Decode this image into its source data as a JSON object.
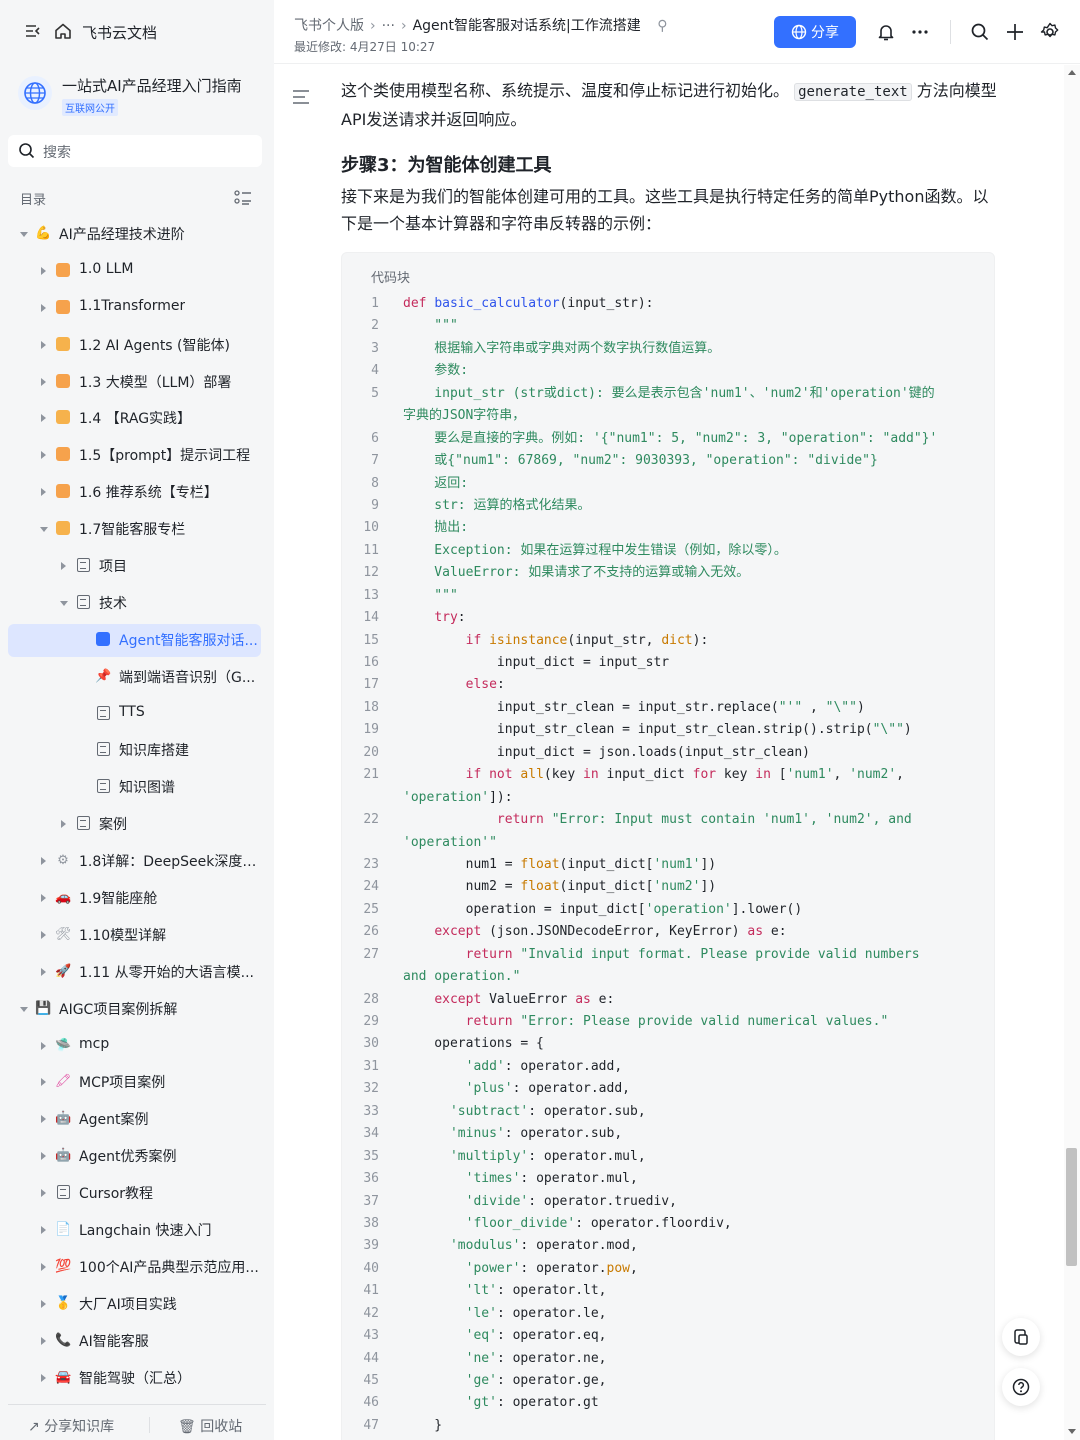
{
  "app": {
    "title": "飞书云文档"
  },
  "knowledge_base": {
    "name": "一站式AI产品经理入门指南",
    "tag": "互联网公开"
  },
  "search": {
    "placeholder": "搜索"
  },
  "toc": {
    "label": "目录"
  },
  "tree": [
    {
      "label": "AI产品经理技术进阶",
      "level": 0,
      "arrow": "down",
      "icon": "emoji",
      "glyph": "💪",
      "color": "#f5a623"
    },
    {
      "label": "1.0 LLM",
      "level": 1,
      "arrow": "right",
      "icon": "square",
      "color": "#f6a24c"
    },
    {
      "label": "1.1Transformer",
      "level": 1,
      "arrow": "right",
      "icon": "square",
      "color": "#f6a24c"
    },
    {
      "label": "1.2 AI Agents (智能体)",
      "level": 1,
      "arrow": "right",
      "icon": "square",
      "color": "#f6b24c"
    },
    {
      "label": "1.3 大模型（LLM）部署",
      "level": 1,
      "arrow": "right",
      "icon": "square",
      "color": "#f6a24c"
    },
    {
      "label": "1.4 【RAG实践】",
      "level": 1,
      "arrow": "right",
      "icon": "square",
      "color": "#f6b24c"
    },
    {
      "label": "1.5【prompt】提示词工程",
      "level": 1,
      "arrow": "right",
      "icon": "square",
      "color": "#f6a24c"
    },
    {
      "label": "1.6 推荐系统【专栏】",
      "level": 1,
      "arrow": "right",
      "icon": "square",
      "color": "#f6a24c"
    },
    {
      "label": "1.7智能客服专栏",
      "level": 1,
      "arrow": "down",
      "icon": "square",
      "color": "#f6b24c"
    },
    {
      "label": "项目",
      "level": 2,
      "arrow": "right",
      "icon": "doc"
    },
    {
      "label": "技术",
      "level": 2,
      "arrow": "down",
      "icon": "doc"
    },
    {
      "label": "Agent智能客服对话...",
      "level": 3,
      "arrow": "",
      "icon": "doc-blue",
      "active": true
    },
    {
      "label": "端到端语音识别（G...",
      "level": 3,
      "arrow": "",
      "icon": "emoji",
      "glyph": "📌",
      "color": "#e03e3e"
    },
    {
      "label": "TTS",
      "level": 3,
      "arrow": "",
      "icon": "doc"
    },
    {
      "label": "知识库搭建",
      "level": 3,
      "arrow": "",
      "icon": "doc"
    },
    {
      "label": "知识图谱",
      "level": 3,
      "arrow": "",
      "icon": "doc"
    },
    {
      "label": "案例",
      "level": 2,
      "arrow": "right",
      "icon": "doc"
    },
    {
      "label": "1.8详解：DeepSeek深度推...",
      "level": 1,
      "arrow": "right",
      "icon": "emoji",
      "glyph": "⚙",
      "color": "#8f959e"
    },
    {
      "label": "1.9智能座舱",
      "level": 1,
      "arrow": "right",
      "icon": "emoji",
      "glyph": "🚗",
      "color": "#e03e3e"
    },
    {
      "label": "1.10模型详解",
      "level": 1,
      "arrow": "right",
      "icon": "emoji",
      "glyph": "🛠",
      "color": "#8f959e"
    },
    {
      "label": "1.11 从零开始的大语言模...",
      "level": 1,
      "arrow": "right",
      "icon": "emoji",
      "glyph": "🚀",
      "color": "#3370ff"
    },
    {
      "label": "AIGC项目案例拆解",
      "level": 0,
      "arrow": "down",
      "icon": "emoji",
      "glyph": "💾",
      "color": "#7a3bc4"
    },
    {
      "label": "mcp",
      "level": 1,
      "arrow": "right",
      "icon": "emoji",
      "glyph": "🛸",
      "color": "#3370ff"
    },
    {
      "label": "MCP项目案例",
      "level": 1,
      "arrow": "right",
      "icon": "emoji",
      "glyph": "🖍",
      "color": "#e0479e"
    },
    {
      "label": "Agent案例",
      "level": 1,
      "arrow": "right",
      "icon": "emoji",
      "glyph": "🤖",
      "color": "#646a73"
    },
    {
      "label": "Agent优秀案例",
      "level": 1,
      "arrow": "right",
      "icon": "emoji",
      "glyph": "🤖",
      "color": "#646a73"
    },
    {
      "label": "Cursor教程",
      "level": 1,
      "arrow": "right",
      "icon": "doc"
    },
    {
      "label": "Langchain 快速入门",
      "level": 1,
      "arrow": "right",
      "icon": "emoji",
      "glyph": "📄",
      "color": "#e03e3e"
    },
    {
      "label": "100个AI产品典型示范应用...",
      "level": 1,
      "arrow": "right",
      "icon": "emoji",
      "glyph": "💯",
      "color": "#e03e3e"
    },
    {
      "label": "大厂AI项目实践",
      "level": 1,
      "arrow": "right",
      "icon": "emoji",
      "glyph": "🥇",
      "color": "#f5a623"
    },
    {
      "label": "AI智能客服",
      "level": 1,
      "arrow": "right",
      "icon": "emoji",
      "glyph": "📞",
      "color": "#e03e3e"
    },
    {
      "label": "智能驾驶（汇总）",
      "level": 1,
      "arrow": "right",
      "icon": "emoji",
      "glyph": "🚘",
      "color": "#e03e3e"
    }
  ],
  "sidebar_bottom": {
    "share_kb": "分享知识库",
    "recycle": "回收站"
  },
  "header": {
    "crumb_root": "飞书个人版",
    "crumb_more": "···",
    "crumb_title": "Agent智能客服对话系统|工作流搭建",
    "modified": "最近修改: 4月27日 10:27",
    "share_label": "分享"
  },
  "content": {
    "para1_a": "这个类使用模型名称、系统提示、温度和停止标记进行初始化。",
    "para1_code": "generate_text",
    "para1_b": "方法向模型API发送请求并返回响应。",
    "step3": "步骤3：为智能体创建工具",
    "para2": "接下来是为我们的智能体创建可用的工具。这些工具是执行特定任务的简单Python函数。以下是一个基本计算器和字符串反转器的示例：",
    "codeblock_title": "代码块"
  },
  "code_lines": [
    {
      "n": "1",
      "segs": [
        [
          "k",
          "def "
        ],
        [
          "f",
          "basic_calculator"
        ],
        [
          "",
          "(input_str):"
        ]
      ]
    },
    {
      "n": "2",
      "segs": [
        [
          "d",
          "    \"\"\""
        ]
      ]
    },
    {
      "n": "3",
      "segs": [
        [
          "d",
          "    根据输入字符串或字典对两个数字执行数值运算。"
        ]
      ]
    },
    {
      "n": "4",
      "segs": [
        [
          "d",
          "    参数:"
        ]
      ]
    },
    {
      "n": "5",
      "segs": [
        [
          "d",
          "    input_str (str或dict): 要么是表示包含'num1'、'num2'和'operation'键的"
        ]
      ]
    },
    {
      "n": "",
      "segs": [
        [
          "d",
          "字典的JSON字符串，"
        ]
      ]
    },
    {
      "n": "6",
      "segs": [
        [
          "d",
          "    要么是直接的字典。例如: '{\"num1\": 5, \"num2\": 3, \"operation\": \"add\"}'"
        ]
      ]
    },
    {
      "n": "7",
      "segs": [
        [
          "d",
          "    或{\"num1\": 67869, \"num2\": 9030393, \"operation\": \"divide\"}"
        ]
      ]
    },
    {
      "n": "8",
      "segs": [
        [
          "d",
          "    返回:"
        ]
      ]
    },
    {
      "n": "9",
      "segs": [
        [
          "d",
          "    str: 运算的格式化结果。"
        ]
      ]
    },
    {
      "n": "10",
      "segs": [
        [
          "d",
          "    抛出:"
        ]
      ]
    },
    {
      "n": "11",
      "segs": [
        [
          "d",
          "    Exception: 如果在运算过程中发生错误（例如，除以零）。"
        ]
      ]
    },
    {
      "n": "12",
      "segs": [
        [
          "d",
          "    ValueError: 如果请求了不支持的运算或输入无效。"
        ]
      ]
    },
    {
      "n": "13",
      "segs": [
        [
          "d",
          "    \"\"\""
        ]
      ]
    },
    {
      "n": "14",
      "segs": [
        [
          "",
          "    "
        ],
        [
          "k",
          "try"
        ],
        [
          "",
          ":"
        ]
      ]
    },
    {
      "n": "15",
      "segs": [
        [
          "",
          "        "
        ],
        [
          "k",
          "if "
        ],
        [
          "b",
          "isinstance"
        ],
        [
          "",
          "(input_str, "
        ],
        [
          "b",
          "dict"
        ],
        [
          "",
          "):"
        ]
      ]
    },
    {
      "n": "16",
      "segs": [
        [
          "",
          "            input_dict = input_str"
        ]
      ]
    },
    {
      "n": "17",
      "segs": [
        [
          "",
          "        "
        ],
        [
          "k",
          "else"
        ],
        [
          "",
          ":"
        ]
      ]
    },
    {
      "n": "18",
      "segs": [
        [
          "",
          "            input_str_clean = input_str.replace("
        ],
        [
          "s",
          "\"'\""
        ],
        [
          "",
          " , "
        ],
        [
          "s",
          "\"\\\"\""
        ],
        [
          "",
          ")"
        ]
      ]
    },
    {
      "n": "19",
      "segs": [
        [
          "",
          "            input_str_clean = input_str_clean.strip().strip("
        ],
        [
          "s",
          "\"\\\"\""
        ],
        [
          "",
          ")"
        ]
      ]
    },
    {
      "n": "20",
      "segs": [
        [
          "",
          "            input_dict = json.loads(input_str_clean)"
        ]
      ]
    },
    {
      "n": "21",
      "segs": [
        [
          "",
          "        "
        ],
        [
          "k",
          "if not "
        ],
        [
          "b",
          "all"
        ],
        [
          "",
          "(key "
        ],
        [
          "k",
          "in"
        ],
        [
          "",
          " input_dict "
        ],
        [
          "k",
          "for"
        ],
        [
          "",
          " key "
        ],
        [
          "k",
          "in"
        ],
        [
          "",
          " ["
        ],
        [
          "s",
          "'num1'"
        ],
        [
          "",
          ", "
        ],
        [
          "s",
          "'num2'"
        ],
        [
          "",
          ","
        ]
      ]
    },
    {
      "n": "",
      "segs": [
        [
          "s",
          "'operation'"
        ],
        [
          "",
          "]):"
        ]
      ]
    },
    {
      "n": "22",
      "segs": [
        [
          "",
          "            "
        ],
        [
          "k",
          "return "
        ],
        [
          "s",
          "\"Error: Input must contain 'num1', 'num2', and"
        ]
      ]
    },
    {
      "n": "",
      "segs": [
        [
          "s",
          "'operation'\""
        ]
      ]
    },
    {
      "n": "23",
      "segs": [
        [
          "",
          "        num1 = "
        ],
        [
          "b",
          "float"
        ],
        [
          "",
          "(input_dict["
        ],
        [
          "s",
          "'num1'"
        ],
        [
          "",
          "])"
        ]
      ]
    },
    {
      "n": "24",
      "segs": [
        [
          "",
          "        num2 = "
        ],
        [
          "b",
          "float"
        ],
        [
          "",
          "(input_dict["
        ],
        [
          "s",
          "'num2'"
        ],
        [
          "",
          "])"
        ]
      ]
    },
    {
      "n": "25",
      "segs": [
        [
          "",
          "        operation = input_dict["
        ],
        [
          "s",
          "'operation'"
        ],
        [
          "",
          "].lower()"
        ]
      ]
    },
    {
      "n": "26",
      "segs": [
        [
          "",
          "    "
        ],
        [
          "k",
          "except"
        ],
        [
          "",
          " (json.JSONDecodeError, KeyError) "
        ],
        [
          "k",
          "as"
        ],
        [
          "",
          " e:"
        ]
      ]
    },
    {
      "n": "27",
      "segs": [
        [
          "",
          "        "
        ],
        [
          "k",
          "return "
        ],
        [
          "s",
          "\"Invalid input format. Please provide valid numbers"
        ]
      ]
    },
    {
      "n": "",
      "segs": [
        [
          "s",
          "and operation.\""
        ]
      ]
    },
    {
      "n": "28",
      "segs": [
        [
          "",
          "    "
        ],
        [
          "k",
          "except"
        ],
        [
          "",
          " ValueError "
        ],
        [
          "k",
          "as"
        ],
        [
          "",
          " e:"
        ]
      ]
    },
    {
      "n": "29",
      "segs": [
        [
          "",
          "        "
        ],
        [
          "k",
          "return "
        ],
        [
          "s",
          "\"Error: Please provide valid numerical values.\""
        ]
      ]
    },
    {
      "n": "30",
      "segs": [
        [
          "",
          "    operations = {"
        ]
      ]
    },
    {
      "n": "31",
      "segs": [
        [
          "",
          "        "
        ],
        [
          "s",
          "'add'"
        ],
        [
          "",
          ": operator.add,"
        ]
      ]
    },
    {
      "n": "32",
      "segs": [
        [
          "",
          "        "
        ],
        [
          "s",
          "'plus'"
        ],
        [
          "",
          ": operator.add,"
        ]
      ]
    },
    {
      "n": "33",
      "segs": [
        [
          "",
          "      "
        ],
        [
          "s",
          "'subtract'"
        ],
        [
          "",
          ": operator.sub,"
        ]
      ]
    },
    {
      "n": "34",
      "segs": [
        [
          "",
          "      "
        ],
        [
          "s",
          "'minus'"
        ],
        [
          "",
          ": operator.sub,"
        ]
      ]
    },
    {
      "n": "35",
      "segs": [
        [
          "",
          "      "
        ],
        [
          "s",
          "'multiply'"
        ],
        [
          "",
          ": operator.mul,"
        ]
      ]
    },
    {
      "n": "36",
      "segs": [
        [
          "",
          "        "
        ],
        [
          "s",
          "'times'"
        ],
        [
          "",
          ": operator.mul,"
        ]
      ]
    },
    {
      "n": "37",
      "segs": [
        [
          "",
          "        "
        ],
        [
          "s",
          "'divide'"
        ],
        [
          "",
          ": operator.truediv,"
        ]
      ]
    },
    {
      "n": "38",
      "segs": [
        [
          "",
          "        "
        ],
        [
          "s",
          "'floor_divide'"
        ],
        [
          "",
          ": operator.floordiv,"
        ]
      ]
    },
    {
      "n": "39",
      "segs": [
        [
          "",
          "      "
        ],
        [
          "s",
          "'modulus'"
        ],
        [
          "",
          ": operator.mod,"
        ]
      ]
    },
    {
      "n": "40",
      "segs": [
        [
          "",
          "        "
        ],
        [
          "s",
          "'power'"
        ],
        [
          "",
          ": operator."
        ],
        [
          "b",
          "pow"
        ],
        [
          "",
          ","
        ]
      ]
    },
    {
      "n": "41",
      "segs": [
        [
          "",
          "        "
        ],
        [
          "s",
          "'lt'"
        ],
        [
          "",
          ": operator.lt,"
        ]
      ]
    },
    {
      "n": "42",
      "segs": [
        [
          "",
          "        "
        ],
        [
          "s",
          "'le'"
        ],
        [
          "",
          ": operator.le,"
        ]
      ]
    },
    {
      "n": "43",
      "segs": [
        [
          "",
          "        "
        ],
        [
          "s",
          "'eq'"
        ],
        [
          "",
          ": operator.eq,"
        ]
      ]
    },
    {
      "n": "44",
      "segs": [
        [
          "",
          "        "
        ],
        [
          "s",
          "'ne'"
        ],
        [
          "",
          ": operator.ne,"
        ]
      ]
    },
    {
      "n": "45",
      "segs": [
        [
          "",
          "        "
        ],
        [
          "s",
          "'ge'"
        ],
        [
          "",
          ": operator.ge,"
        ]
      ]
    },
    {
      "n": "46",
      "segs": [
        [
          "",
          "        "
        ],
        [
          "s",
          "'gt'"
        ],
        [
          "",
          ": operator.gt"
        ]
      ]
    },
    {
      "n": "47",
      "segs": [
        [
          "",
          "    }"
        ]
      ]
    }
  ],
  "colors": {
    "accent": "#3370ff",
    "active_bg": "#dde6ff",
    "sidebar_bg": "#f5f6f7"
  }
}
